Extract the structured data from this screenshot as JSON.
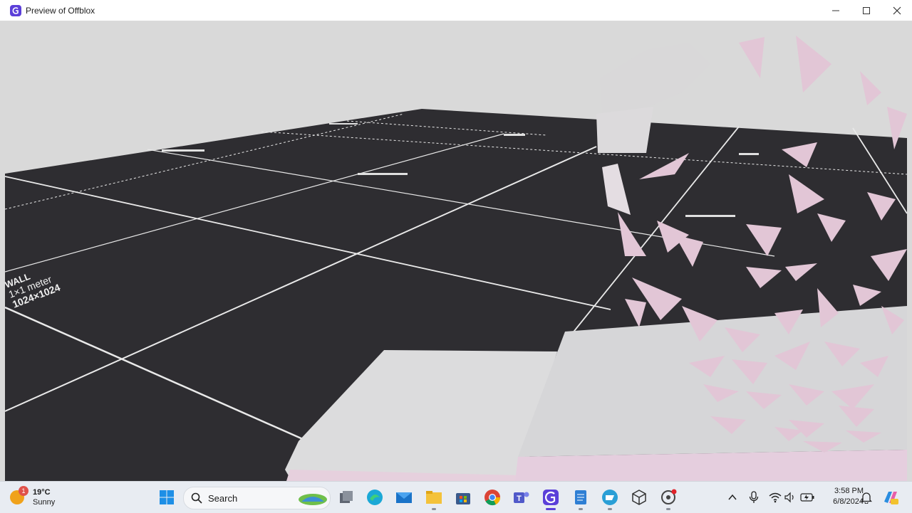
{
  "window": {
    "title": "Preview of Offblox",
    "icon": "offblox-app-icon",
    "controls": [
      "minimize-icon",
      "maximize-icon",
      "close-icon"
    ]
  },
  "scene": {
    "labels": {
      "wall_title": "WALL",
      "wall_size": "1×1 meter",
      "wall_res": "1024×1024"
    },
    "colors": {
      "sky": "#d9d9d9",
      "floor": "#2e2d31",
      "grid_line": "#e9e9e9",
      "block": "#d6d6d8",
      "shards": "#e2c6d6"
    }
  },
  "taskbar": {
    "weather": {
      "temp": "19°C",
      "condition": "Sunny",
      "badge": "1"
    },
    "search": {
      "placeholder": "Search"
    },
    "apps": [
      "windows-start-icon",
      "task-view-icon",
      "edge-icon",
      "mail-icon",
      "file-explorer-icon",
      "store-icon",
      "chrome-icon",
      "teams-icon",
      "offblox-icon",
      "notepad-icon",
      "app-icon",
      "3d-viewer-icon",
      "recorder-icon"
    ],
    "clock": {
      "time": "3:58 PM",
      "date": "6/8/2024"
    }
  }
}
